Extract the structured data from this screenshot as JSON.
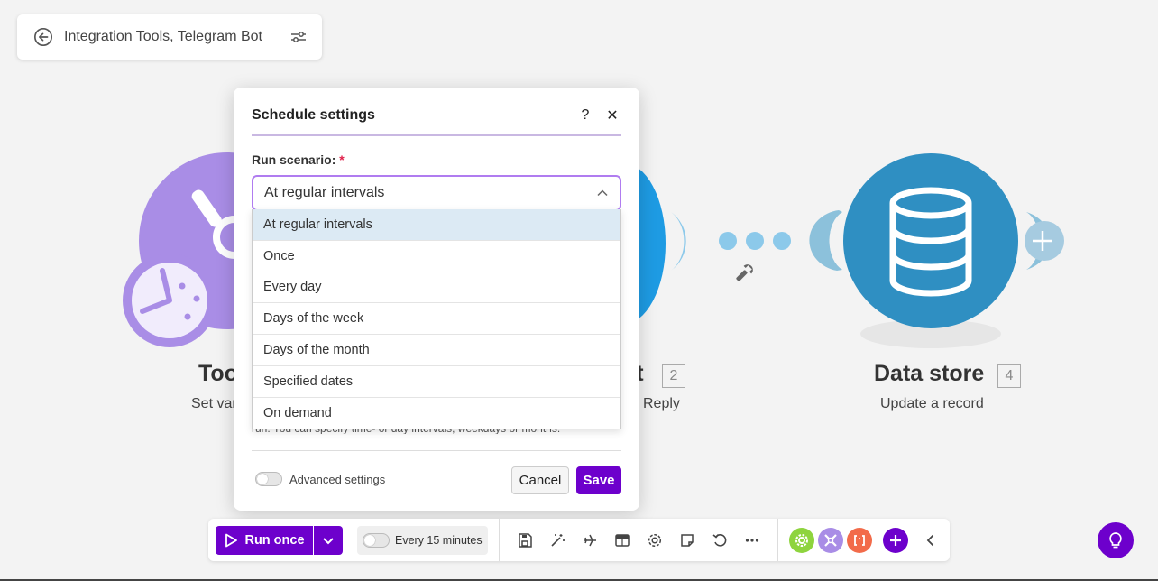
{
  "breadcrumb": {
    "title": "Integration Tools, Telegram Bot"
  },
  "canvas": {
    "modules": [
      {
        "label": "Too",
        "subtitle": "Set var"
      },
      {
        "label": "ot",
        "number": "2",
        "subtitle": "Reply"
      },
      {
        "label": "Data store",
        "number": "4",
        "subtitle": "Update a record"
      }
    ],
    "colors": {
      "tools": "#a98de6",
      "telegram": "#1e9be3",
      "datastore": "#2f8fc2"
    }
  },
  "modal": {
    "title": "Schedule settings",
    "help": "?",
    "close": "✕",
    "run_scenario_label": "Run scenario:",
    "required_mark": "*",
    "selected_value": "At regular intervals",
    "hint": "run. You can specify time- or day intervals, weekdays or months.",
    "advanced_label": "Advanced settings",
    "cancel": "Cancel",
    "save": "Save",
    "options": [
      "At regular intervals",
      "Once",
      "Every day",
      "Days of the week",
      "Days of the month",
      "Specified dates",
      "On demand"
    ]
  },
  "toolbar": {
    "run_once": "Run once",
    "schedule": "Every 15 minutes",
    "accent": "#6d00cc"
  }
}
